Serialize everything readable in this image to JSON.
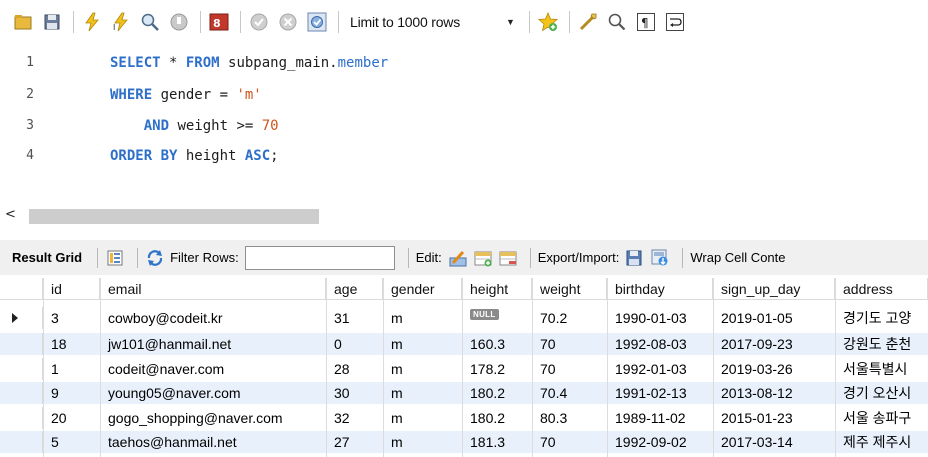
{
  "toolbar": {
    "limit_label": "Limit to 1000 rows",
    "icons": [
      "open-folder-icon",
      "save-icon",
      "execute-icon",
      "execute-current-icon",
      "explain-icon",
      "stop-icon",
      "toggle-error-icon",
      "commit-icon",
      "rollback-icon",
      "autocommit-icon",
      "add-snippet-icon",
      "beautify-icon",
      "find-icon",
      "invisible-chars-icon",
      "wrap-icon"
    ]
  },
  "editor": {
    "lines": [
      {
        "no": "1"
      },
      {
        "no": "2"
      },
      {
        "no": "3"
      },
      {
        "no": "4"
      }
    ],
    "line1": {
      "kw1": "SELECT",
      "star": " * ",
      "kw2": "FROM",
      "schema": " subpang_main.",
      "table": "member"
    },
    "line2": {
      "kw1": "WHERE",
      "rest": " gender = ",
      "str": "'m'"
    },
    "line3": {
      "indent": "    ",
      "kw1": "AND",
      "rest": " weight >= ",
      "num": "70"
    },
    "line4": {
      "kw1": "ORDER BY",
      "rest": " height ",
      "kw2": "ASC",
      "end": ";"
    }
  },
  "result_toolbar": {
    "title": "Result Grid",
    "filter_label": "Filter Rows:",
    "edit_label": "Edit:",
    "export_label": "Export/Import:",
    "wrap_label": "Wrap Cell Conte"
  },
  "grid": {
    "columns": [
      "id",
      "email",
      "age",
      "gender",
      "height",
      "weight",
      "birthday",
      "sign_up_day",
      "address"
    ],
    "null_label": "NULL",
    "rows": [
      [
        "3",
        "cowboy@codeit.kr",
        "31",
        "m",
        null,
        "70.2",
        "1990-01-03",
        "2019-01-05",
        "경기도 고양"
      ],
      [
        "18",
        "jw101@hanmail.net",
        "0",
        "m",
        "160.3",
        "70",
        "1992-08-03",
        "2017-09-23",
        "강원도 춘천"
      ],
      [
        "1",
        "codeit@naver.com",
        "28",
        "m",
        "178.2",
        "70",
        "1992-01-03",
        "2019-03-26",
        "서울특별시"
      ],
      [
        "9",
        "young05@naver.com",
        "30",
        "m",
        "180.2",
        "70.4",
        "1991-02-13",
        "2013-08-12",
        "경기 오산시"
      ],
      [
        "20",
        "gogo_shopping@naver.com",
        "32",
        "m",
        "180.2",
        "80.3",
        "1989-11-02",
        "2015-01-23",
        "서울 송파구"
      ],
      [
        "5",
        "taehos@hanmail.net",
        "27",
        "m",
        "181.3",
        "70",
        "1992-09-02",
        "2017-03-14",
        "제주 제주시"
      ]
    ]
  }
}
